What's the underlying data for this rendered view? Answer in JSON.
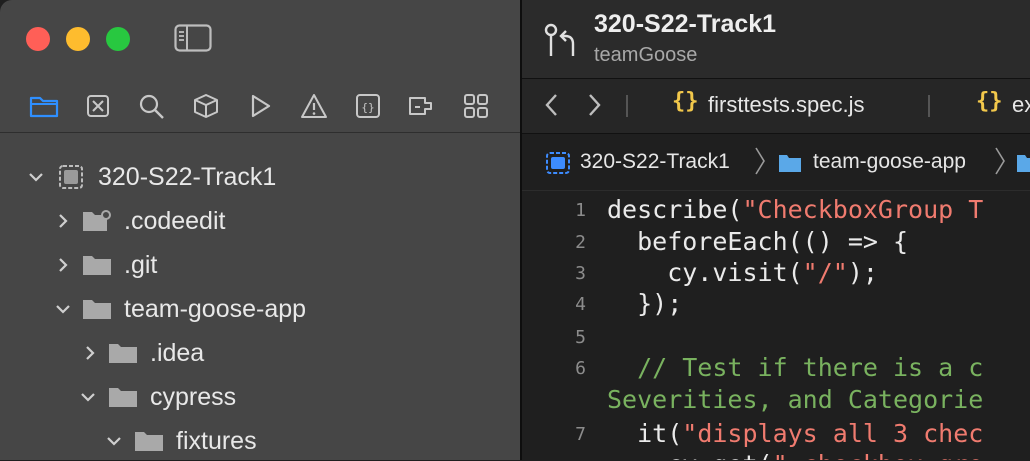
{
  "window": {
    "controls": [
      "close",
      "minimize",
      "zoom"
    ],
    "sidebar_toggle_icon": "sidebar-toggle-icon"
  },
  "navigator": {
    "tabs": [
      {
        "icon": "folder-icon",
        "active": true
      },
      {
        "icon": "source-control-icon"
      },
      {
        "icon": "search-icon"
      },
      {
        "icon": "package-icon"
      },
      {
        "icon": "run-icon"
      },
      {
        "icon": "warning-icon"
      },
      {
        "icon": "braces-icon"
      },
      {
        "icon": "extension-icon"
      },
      {
        "icon": "grid-icon"
      }
    ],
    "accent": "#2f8fff"
  },
  "file_tree": [
    {
      "label": "320-S22-Track1",
      "expanded": true,
      "type": "project"
    },
    {
      "label": ".codeedit",
      "expanded": false,
      "type": "settings-folder"
    },
    {
      "label": ".git",
      "expanded": false,
      "type": "folder"
    },
    {
      "label": "team-goose-app",
      "expanded": true,
      "type": "folder"
    },
    {
      "label": ".idea",
      "expanded": false,
      "type": "folder"
    },
    {
      "label": "cypress",
      "expanded": true,
      "type": "folder"
    },
    {
      "label": "fixtures",
      "expanded": true,
      "type": "folder"
    }
  ],
  "toolbar": {
    "project_name": "320-S22-Track1",
    "branch": "teamGoose"
  },
  "tabs": [
    {
      "icon": "{}",
      "label": "firsttests.spec.js"
    },
    {
      "icon": "{}",
      "label": "ex"
    }
  ],
  "breadcrumb": [
    {
      "label": "320-S22-Track1",
      "icon": "project-icon"
    },
    {
      "label": "team-goose-app",
      "icon": "folder-icon"
    }
  ],
  "editor": {
    "lines": [
      {
        "num": "1",
        "parts": [
          {
            "t": "describe(",
            "c": ""
          },
          {
            "t": "\"CheckboxGroup T",
            "c": "str"
          }
        ]
      },
      {
        "num": "2",
        "parts": [
          {
            "t": "  beforeEach(() => {",
            "c": ""
          }
        ]
      },
      {
        "num": "3",
        "parts": [
          {
            "t": "    cy.visit(",
            "c": ""
          },
          {
            "t": "\"/\"",
            "c": "str"
          },
          {
            "t": ");",
            "c": ""
          }
        ]
      },
      {
        "num": "4",
        "parts": [
          {
            "t": "  });",
            "c": ""
          }
        ]
      },
      {
        "num": "5",
        "parts": []
      },
      {
        "num": "6",
        "parts": [
          {
            "t": "  // Test if there is a c",
            "c": "cmt"
          }
        ]
      },
      {
        "num": "",
        "parts": [
          {
            "t": "Severities, and Categorie",
            "c": "cmt"
          }
        ]
      },
      {
        "num": "7",
        "parts": [
          {
            "t": "  it(",
            "c": ""
          },
          {
            "t": "\"displays all 3 chec",
            "c": "str"
          }
        ]
      },
      {
        "num": "",
        "parts": [
          {
            "t": "    cy.get(",
            "c": ""
          },
          {
            "t": "\".checkbox-gro",
            "c": "str"
          }
        ]
      }
    ]
  }
}
